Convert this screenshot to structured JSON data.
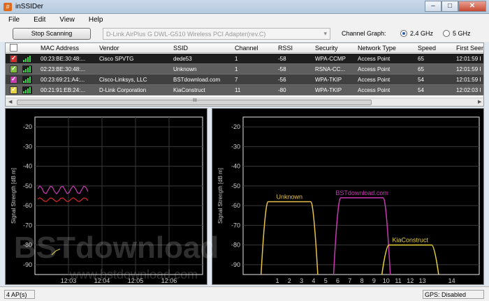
{
  "window": {
    "title": "inSSIDer",
    "controls": {
      "minimize": "–",
      "maximize": "□",
      "close": "✕"
    }
  },
  "menu": [
    {
      "label": "File"
    },
    {
      "label": "Edit"
    },
    {
      "label": "View"
    },
    {
      "label": "Help"
    }
  ],
  "toolbar": {
    "stop_label": "Stop Scanning",
    "adapter": "D-Link AirPlus G DWL-G510 Wireless PCI Adapter(rev.C)",
    "channel_graph_label": "Channel Graph:",
    "band_options": [
      {
        "label": "2.4 GHz",
        "selected": true
      },
      {
        "label": "5 GHz",
        "selected": false
      }
    ]
  },
  "table": {
    "columns": [
      "MAC Address",
      "Vendor",
      "SSID",
      "Channel",
      "RSSI",
      "Security",
      "Network Type",
      "Speed",
      "First Seen"
    ],
    "rows": [
      {
        "color": "#d42b2b",
        "mac": "00:23:BE:30:48:...",
        "vendor": "Cisco SPVTG",
        "ssid": "dede53",
        "channel": "1",
        "rssi": "-58",
        "security": "WPA-CCMP",
        "type": "Access Point",
        "speed": "65",
        "first_seen": "12:01:59 P"
      },
      {
        "color": "#7cc03a",
        "mac": "02:23:BE:30:48:...",
        "vendor": "",
        "ssid": "Unknown",
        "channel": "1",
        "rssi": "-58",
        "security": "RSNA-CC...",
        "type": "Access Point",
        "speed": "65",
        "first_seen": "12:01:59 P"
      },
      {
        "color": "#c83ab4",
        "mac": "00:23:69:21:A4:...",
        "vendor": "Cisco-Linksys, LLC",
        "ssid": "BSTdownload.com",
        "channel": "7",
        "rssi": "-56",
        "security": "WPA-TKIP",
        "type": "Access Point",
        "speed": "54",
        "first_seen": "12:01:59 P"
      },
      {
        "color": "#e6d23c",
        "mac": "00:21:91:EB:24:...",
        "vendor": "D-Link Corporation",
        "ssid": "KiaConstruct",
        "channel": "11",
        "rssi": "-80",
        "security": "WPA-TKIP",
        "type": "Access Point",
        "speed": "54",
        "first_seen": "12:02:03 P"
      }
    ],
    "scroll_grip": "III"
  },
  "time_graph": {
    "ylabel": "Signal Strength [dB m]",
    "yticks": [
      "-20",
      "-30",
      "-40",
      "-50",
      "-60",
      "-70",
      "-80",
      "-90"
    ],
    "xticks": [
      "12:03",
      "12:04",
      "12:05",
      "12:06"
    ]
  },
  "channel_graph": {
    "ylabel": "Signal Strength [dB m]",
    "yticks": [
      "-20",
      "-30",
      "-40",
      "-50",
      "-60",
      "-70",
      "-80",
      "-90"
    ],
    "xticks": [
      "1",
      "2",
      "3",
      "4",
      "5",
      "6",
      "7",
      "8",
      "9",
      "10",
      "11",
      "12",
      "13",
      "14"
    ],
    "networks": [
      {
        "label": "Unknown",
        "color": "#e6c24a",
        "channel": 1,
        "rssi": -58
      },
      {
        "label": "BSTdownload.com",
        "color": "#c83ab4",
        "channel": 7,
        "rssi": -56
      },
      {
        "label": "KiaConstruct",
        "color": "#e6d23c",
        "channel": 11,
        "rssi": -80
      }
    ]
  },
  "watermark": {
    "main": "BSTdownload",
    "sub": "www.bstdownload.com"
  },
  "status": {
    "ap_count": "4 AP(s)",
    "gps": "GPS: Disabled"
  }
}
